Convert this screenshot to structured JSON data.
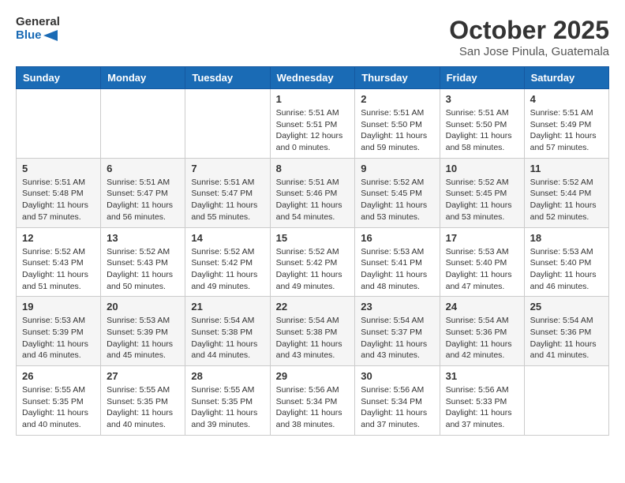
{
  "logo": {
    "general": "General",
    "blue": "Blue"
  },
  "title": "October 2025",
  "subtitle": "San Jose Pinula, Guatemala",
  "days_of_week": [
    "Sunday",
    "Monday",
    "Tuesday",
    "Wednesday",
    "Thursday",
    "Friday",
    "Saturday"
  ],
  "weeks": [
    [
      {
        "day": "",
        "sunrise": "",
        "sunset": "",
        "daylight": ""
      },
      {
        "day": "",
        "sunrise": "",
        "sunset": "",
        "daylight": ""
      },
      {
        "day": "",
        "sunrise": "",
        "sunset": "",
        "daylight": ""
      },
      {
        "day": "1",
        "sunrise": "Sunrise: 5:51 AM",
        "sunset": "Sunset: 5:51 PM",
        "daylight": "Daylight: 12 hours and 0 minutes."
      },
      {
        "day": "2",
        "sunrise": "Sunrise: 5:51 AM",
        "sunset": "Sunset: 5:50 PM",
        "daylight": "Daylight: 11 hours and 59 minutes."
      },
      {
        "day": "3",
        "sunrise": "Sunrise: 5:51 AM",
        "sunset": "Sunset: 5:50 PM",
        "daylight": "Daylight: 11 hours and 58 minutes."
      },
      {
        "day": "4",
        "sunrise": "Sunrise: 5:51 AM",
        "sunset": "Sunset: 5:49 PM",
        "daylight": "Daylight: 11 hours and 57 minutes."
      }
    ],
    [
      {
        "day": "5",
        "sunrise": "Sunrise: 5:51 AM",
        "sunset": "Sunset: 5:48 PM",
        "daylight": "Daylight: 11 hours and 57 minutes."
      },
      {
        "day": "6",
        "sunrise": "Sunrise: 5:51 AM",
        "sunset": "Sunset: 5:47 PM",
        "daylight": "Daylight: 11 hours and 56 minutes."
      },
      {
        "day": "7",
        "sunrise": "Sunrise: 5:51 AM",
        "sunset": "Sunset: 5:47 PM",
        "daylight": "Daylight: 11 hours and 55 minutes."
      },
      {
        "day": "8",
        "sunrise": "Sunrise: 5:51 AM",
        "sunset": "Sunset: 5:46 PM",
        "daylight": "Daylight: 11 hours and 54 minutes."
      },
      {
        "day": "9",
        "sunrise": "Sunrise: 5:52 AM",
        "sunset": "Sunset: 5:45 PM",
        "daylight": "Daylight: 11 hours and 53 minutes."
      },
      {
        "day": "10",
        "sunrise": "Sunrise: 5:52 AM",
        "sunset": "Sunset: 5:45 PM",
        "daylight": "Daylight: 11 hours and 53 minutes."
      },
      {
        "day": "11",
        "sunrise": "Sunrise: 5:52 AM",
        "sunset": "Sunset: 5:44 PM",
        "daylight": "Daylight: 11 hours and 52 minutes."
      }
    ],
    [
      {
        "day": "12",
        "sunrise": "Sunrise: 5:52 AM",
        "sunset": "Sunset: 5:43 PM",
        "daylight": "Daylight: 11 hours and 51 minutes."
      },
      {
        "day": "13",
        "sunrise": "Sunrise: 5:52 AM",
        "sunset": "Sunset: 5:43 PM",
        "daylight": "Daylight: 11 hours and 50 minutes."
      },
      {
        "day": "14",
        "sunrise": "Sunrise: 5:52 AM",
        "sunset": "Sunset: 5:42 PM",
        "daylight": "Daylight: 11 hours and 49 minutes."
      },
      {
        "day": "15",
        "sunrise": "Sunrise: 5:52 AM",
        "sunset": "Sunset: 5:42 PM",
        "daylight": "Daylight: 11 hours and 49 minutes."
      },
      {
        "day": "16",
        "sunrise": "Sunrise: 5:53 AM",
        "sunset": "Sunset: 5:41 PM",
        "daylight": "Daylight: 11 hours and 48 minutes."
      },
      {
        "day": "17",
        "sunrise": "Sunrise: 5:53 AM",
        "sunset": "Sunset: 5:40 PM",
        "daylight": "Daylight: 11 hours and 47 minutes."
      },
      {
        "day": "18",
        "sunrise": "Sunrise: 5:53 AM",
        "sunset": "Sunset: 5:40 PM",
        "daylight": "Daylight: 11 hours and 46 minutes."
      }
    ],
    [
      {
        "day": "19",
        "sunrise": "Sunrise: 5:53 AM",
        "sunset": "Sunset: 5:39 PM",
        "daylight": "Daylight: 11 hours and 46 minutes."
      },
      {
        "day": "20",
        "sunrise": "Sunrise: 5:53 AM",
        "sunset": "Sunset: 5:39 PM",
        "daylight": "Daylight: 11 hours and 45 minutes."
      },
      {
        "day": "21",
        "sunrise": "Sunrise: 5:54 AM",
        "sunset": "Sunset: 5:38 PM",
        "daylight": "Daylight: 11 hours and 44 minutes."
      },
      {
        "day": "22",
        "sunrise": "Sunrise: 5:54 AM",
        "sunset": "Sunset: 5:38 PM",
        "daylight": "Daylight: 11 hours and 43 minutes."
      },
      {
        "day": "23",
        "sunrise": "Sunrise: 5:54 AM",
        "sunset": "Sunset: 5:37 PM",
        "daylight": "Daylight: 11 hours and 43 minutes."
      },
      {
        "day": "24",
        "sunrise": "Sunrise: 5:54 AM",
        "sunset": "Sunset: 5:36 PM",
        "daylight": "Daylight: 11 hours and 42 minutes."
      },
      {
        "day": "25",
        "sunrise": "Sunrise: 5:54 AM",
        "sunset": "Sunset: 5:36 PM",
        "daylight": "Daylight: 11 hours and 41 minutes."
      }
    ],
    [
      {
        "day": "26",
        "sunrise": "Sunrise: 5:55 AM",
        "sunset": "Sunset: 5:35 PM",
        "daylight": "Daylight: 11 hours and 40 minutes."
      },
      {
        "day": "27",
        "sunrise": "Sunrise: 5:55 AM",
        "sunset": "Sunset: 5:35 PM",
        "daylight": "Daylight: 11 hours and 40 minutes."
      },
      {
        "day": "28",
        "sunrise": "Sunrise: 5:55 AM",
        "sunset": "Sunset: 5:35 PM",
        "daylight": "Daylight: 11 hours and 39 minutes."
      },
      {
        "day": "29",
        "sunrise": "Sunrise: 5:56 AM",
        "sunset": "Sunset: 5:34 PM",
        "daylight": "Daylight: 11 hours and 38 minutes."
      },
      {
        "day": "30",
        "sunrise": "Sunrise: 5:56 AM",
        "sunset": "Sunset: 5:34 PM",
        "daylight": "Daylight: 11 hours and 37 minutes."
      },
      {
        "day": "31",
        "sunrise": "Sunrise: 5:56 AM",
        "sunset": "Sunset: 5:33 PM",
        "daylight": "Daylight: 11 hours and 37 minutes."
      },
      {
        "day": "",
        "sunrise": "",
        "sunset": "",
        "daylight": ""
      }
    ]
  ]
}
